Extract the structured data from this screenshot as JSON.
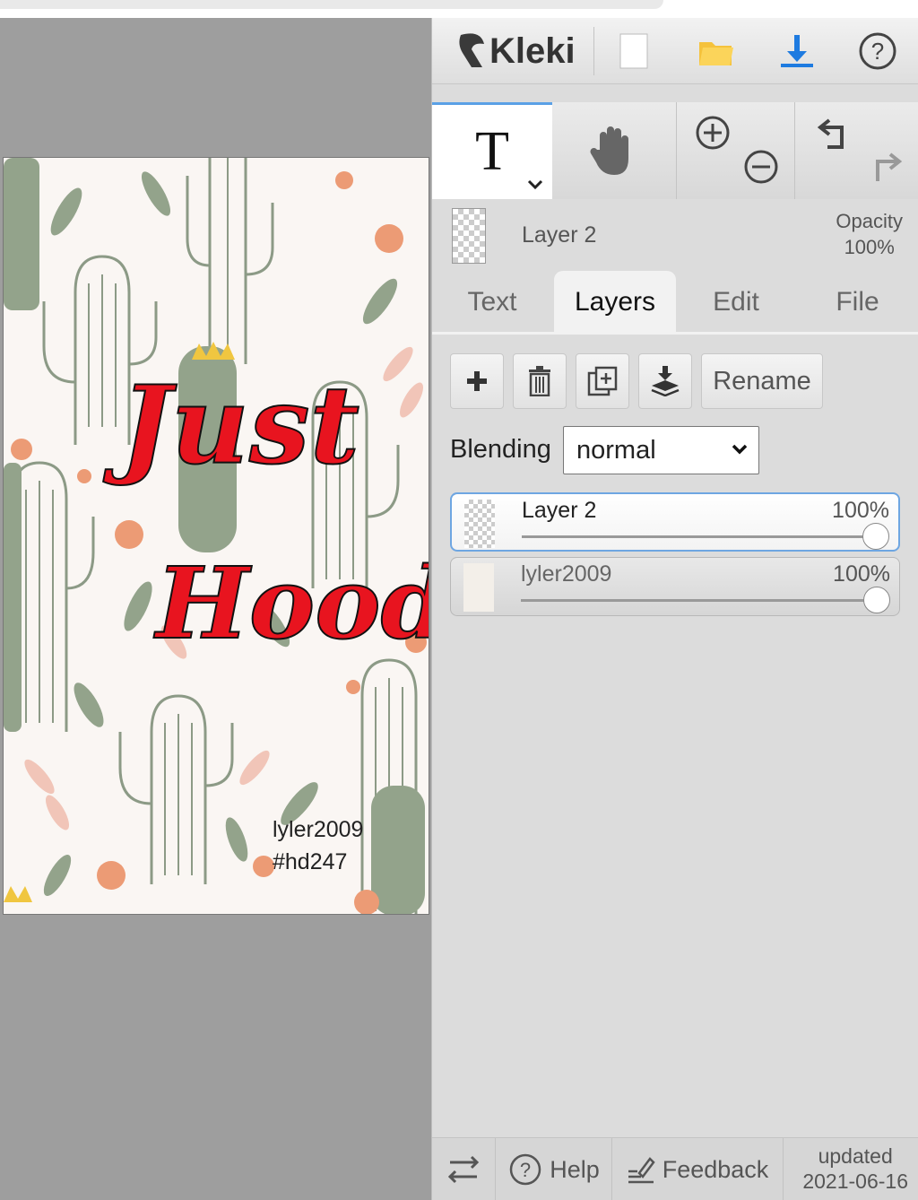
{
  "artwork": {
    "title_line1": "Just",
    "title_line2": "Hood",
    "credit_line1": "lyler2009",
    "credit_line2": "#hd247"
  },
  "header": {
    "logo_text": "Kleki",
    "icons": [
      "new-image-icon",
      "open-folder-icon",
      "download-icon",
      "help-icon"
    ]
  },
  "tools": {
    "active_tool": "T",
    "items": [
      "text-tool-icon",
      "hand-tool-icon",
      "zoom-in-icon",
      "zoom-out-icon",
      "undo-icon",
      "redo-icon"
    ]
  },
  "current_layer": {
    "name": "Layer 2",
    "opacity_label": "Opacity",
    "opacity_value": "100%"
  },
  "tabs": [
    {
      "label": "Text"
    },
    {
      "label": "Layers"
    },
    {
      "label": "Edit"
    },
    {
      "label": "File"
    }
  ],
  "layers_panel": {
    "rename_label": "Rename",
    "blending_label": "Blending",
    "blending_value": "normal",
    "layers": [
      {
        "name": "Layer 2",
        "opacity": "100%",
        "opacity_fraction": 1.0,
        "selected": true
      },
      {
        "name": "lyler2009",
        "opacity": "100%",
        "opacity_fraction": 1.0,
        "selected": false
      }
    ]
  },
  "footer": {
    "help_label": "Help",
    "feedback_label": "Feedback",
    "updated_line1": "updated",
    "updated_line2": "2021-06-16"
  },
  "colors": {
    "accent_blue": "#1e7be0",
    "folder_yellow": "#f5c23c",
    "title_red": "#e8141f",
    "cactus_green": "#8fa08a"
  }
}
